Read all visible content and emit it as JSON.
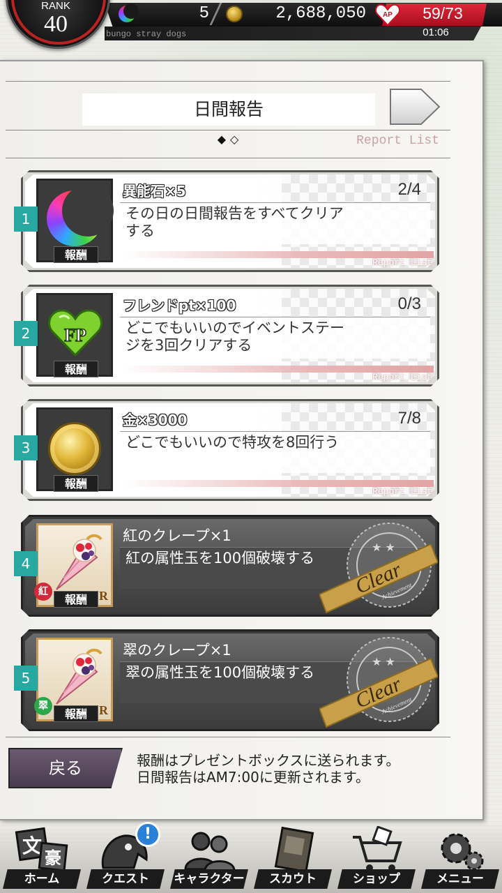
{
  "header": {
    "rank_label": "RANK",
    "rank_value": "40",
    "ability_stones": "5",
    "money": "2,688,050",
    "ap": "59/73",
    "ap_timer": "01:06",
    "brand": "bungo stray dogs",
    "ap_icon": "heart-ap-icon"
  },
  "page": {
    "title": "日間報告",
    "pager": "◆◇",
    "report_list_label": "Report List",
    "current_page": 1,
    "total_pages": 2
  },
  "tasks": [
    {
      "number": "1",
      "reward": "異能石×5",
      "reward_tag": "報酬",
      "description": "その日の日間報告をすべてクリアする",
      "progress": "2/4",
      "report_list": "Report List",
      "completed": false,
      "icon": "ability-stone-moon-icon"
    },
    {
      "number": "2",
      "reward": "フレンドpt×100",
      "reward_tag": "報酬",
      "description": "どこでもいいのでイベントステージを3回クリアする",
      "progress": "0/3",
      "report_list": "Report List",
      "completed": false,
      "icon": "friend-point-heart-icon",
      "icon_text": "FP"
    },
    {
      "number": "3",
      "reward": "金×3000",
      "reward_tag": "報酬",
      "description": "どこでもいいので特攻を8回行う",
      "progress": "7/8",
      "report_list": "Report List",
      "completed": false,
      "icon": "gold-coin-icon"
    },
    {
      "number": "4",
      "reward": "紅のクレープ×1",
      "reward_tag": "報酬",
      "description": "紅の属性玉を100個破壊する",
      "completed": true,
      "seal_text": "Clear",
      "seal_subtext": "Achievement",
      "element": "紅",
      "element_color": "#d22a3a",
      "rarity": "R",
      "icon": "crepe-icon"
    },
    {
      "number": "5",
      "reward": "翠のクレープ×1",
      "reward_tag": "報酬",
      "description": "翠の属性玉を100個破壊する",
      "completed": true,
      "seal_text": "Clear",
      "seal_subtext": "Achievement",
      "element": "翠",
      "element_color": "#2aa84a",
      "rarity": "R",
      "icon": "crepe-icon"
    }
  ],
  "footer": {
    "back_label": "戻る",
    "notice_line1": "報酬はプレゼントボックスに送られます。",
    "notice_line2": "日間報告はAM7:00に更新されます。"
  },
  "nav": [
    {
      "label": "ホーム",
      "icon": "home-icon",
      "glyph": "文豪"
    },
    {
      "label": "クエスト",
      "icon": "quest-icon",
      "alert": "!"
    },
    {
      "label": "キャラクター",
      "icon": "character-icon"
    },
    {
      "label": "スカウト",
      "icon": "scout-icon"
    },
    {
      "label": "ショップ",
      "icon": "shop-icon"
    },
    {
      "label": "メニュー",
      "icon": "menu-gear-icon"
    }
  ],
  "colors": {
    "accent_teal": "#27a9a2",
    "ap_red": "#e0283a",
    "back_button": "#5a4a60"
  }
}
